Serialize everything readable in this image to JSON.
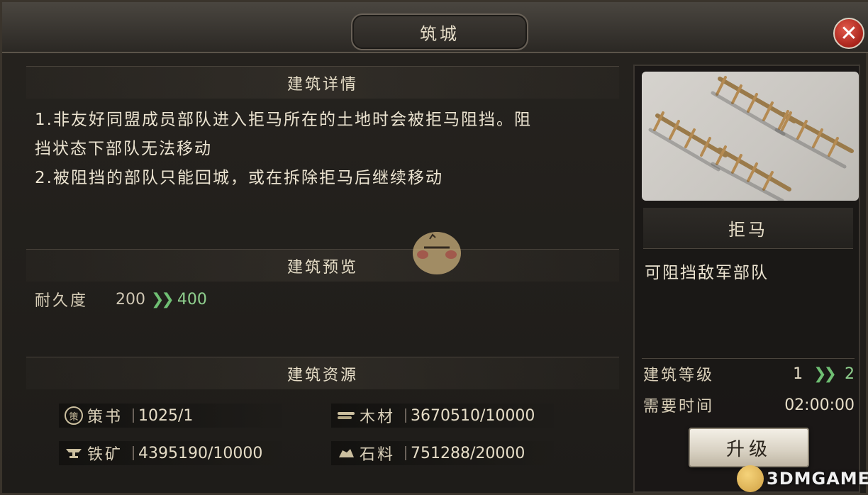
{
  "window": {
    "title": "筑城",
    "close_icon": "close-icon"
  },
  "details": {
    "header": "建筑详情",
    "lines": [
      "1.非友好同盟成员部队进入拒马所在的土地时会被拒马阻挡。阻",
      "挡状态下部队无法移动",
      "2.被阻挡的部队只能回城，或在拆除拒马后继续移动"
    ]
  },
  "preview": {
    "header": "建筑预览",
    "durability_label": "耐久度",
    "durability_from": "200",
    "durability_to": "400"
  },
  "resources": {
    "header": "建筑资源",
    "items": [
      {
        "icon_text": "策",
        "icon": "strategy-book-icon",
        "label": "策书",
        "value": "1025/1"
      },
      {
        "icon": "wood-icon",
        "label": "木材",
        "value": "3670510/10000"
      },
      {
        "icon": "iron-anvil-icon",
        "label": "铁矿",
        "value": "4395190/10000"
      },
      {
        "icon": "stone-icon",
        "label": "石料",
        "value": "751288/20000"
      }
    ]
  },
  "building": {
    "name": "拒马",
    "description": "可阻挡敌军部队",
    "level_label": "建筑等级",
    "level_from": "1",
    "level_to": "2",
    "time_label": "需要时间",
    "time_value": "02:00:00",
    "upgrade_label": "升级"
  },
  "watermark": {
    "text": "3DMGAME"
  },
  "colors": {
    "accent_green": "#6fbf73",
    "close_red": "#c0392b",
    "text_light": "#ece4d1"
  }
}
